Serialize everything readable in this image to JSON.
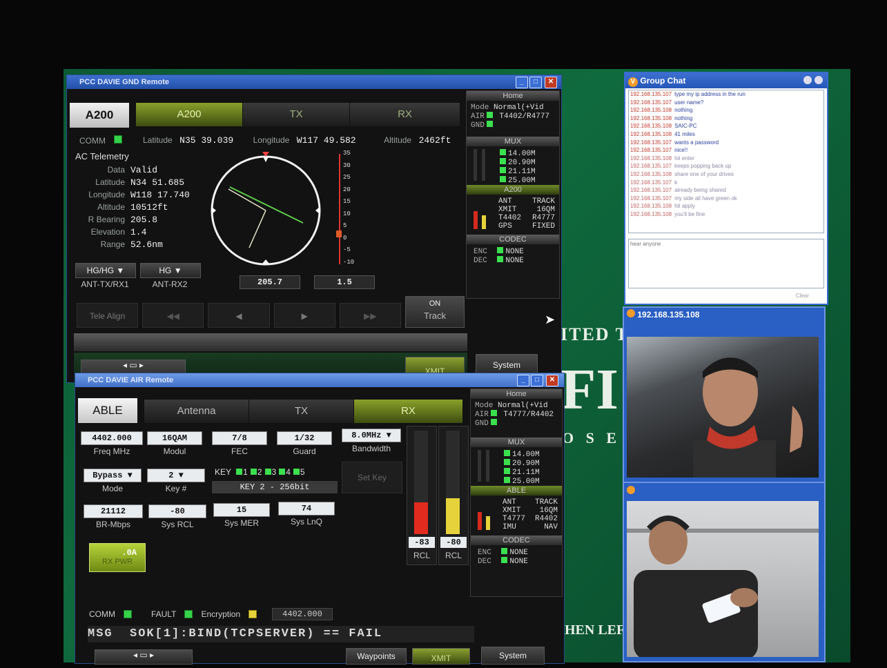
{
  "gnd": {
    "title": "PCC DAVIE GND Remote",
    "name_box": "A200",
    "tabs": [
      "A200",
      "TX",
      "RX"
    ],
    "comm_label": "COMM",
    "latitude_label": "Latitude",
    "latitude_value": "N35 39.039",
    "longitude_label": "Longitude",
    "longitude_value": "W117 49.582",
    "altitude_label": "Altitude",
    "altitude_value": "2462ft",
    "telemetry": {
      "heading": "AC Telemetry",
      "rows": [
        {
          "label": "Data",
          "value": "Valid"
        },
        {
          "label": "Latitude",
          "value": "N34 51.685"
        },
        {
          "label": "Longitude",
          "value": "W118 17.740"
        },
        {
          "label": "Altitude",
          "value": "10512ft"
        },
        {
          "label": "R Bearing",
          "value": "205.8"
        },
        {
          "label": "Elevation",
          "value": "1.4"
        },
        {
          "label": "Range",
          "value": "52.6nm"
        }
      ]
    },
    "scale_ticks": [
      "35",
      "30",
      "25",
      "20",
      "15",
      "10",
      "5",
      "0",
      "-5",
      "-10"
    ],
    "bearing_readout": "205.7",
    "elevation_readout": "1.5",
    "ant_tx": {
      "value": "HG/HG",
      "label": "ANT-TX/RX1"
    },
    "ant_rx": {
      "value": "HG",
      "label": "ANT-RX2"
    },
    "tele_align": "Tele Align",
    "on_label": "ON",
    "track_label": "Track",
    "system_label": "System",
    "xmit_label": "XMIT",
    "status": {
      "home_label": "Home",
      "mode_label": "Mode",
      "mode_value": "Normal(+Vid",
      "air_label": "AIR",
      "gnd_label": "GND",
      "link_value": "T4402/R4777",
      "mux_label": "MUX",
      "mux_values": [
        "14.00M",
        "20.90M",
        "21.11M",
        "25.00M"
      ],
      "section_label": "A200",
      "ant_label": "ANT",
      "track_label": "TRACK",
      "xmit_label": "XMIT",
      "xmit_value": "16QM",
      "t_label": "T4402",
      "r_label": "R4777",
      "gps_label": "GPS",
      "gps_value": "FIXED",
      "codec_label": "CODEC",
      "enc_label": "ENC",
      "dec_label": "DEC",
      "enc_value": "NONE",
      "dec_value": "NONE"
    }
  },
  "air": {
    "title": "PCC DAVIE AIR Remote",
    "name_box": "ABLE",
    "tabs": [
      "Antenna",
      "TX",
      "RX"
    ],
    "freq": {
      "value": "4402.000",
      "label": "Freq MHz"
    },
    "modul": {
      "value": "16QAM",
      "label": "Modul"
    },
    "fec": {
      "value": "7/8",
      "label": "FEC"
    },
    "guard": {
      "value": "1/32",
      "label": "Guard"
    },
    "bandwidth": {
      "value": "8.0MHz",
      "label": "Bandwidth"
    },
    "mode": {
      "value": "Bypass",
      "label": "Mode"
    },
    "key_num": {
      "value": "2",
      "label": "Key #"
    },
    "key_label": "KEY",
    "key_slots": [
      "1",
      "2",
      "3",
      "4",
      "5"
    ],
    "key_info": "KEY 2 - 256bit",
    "set_key": "Set Key",
    "br": {
      "value": "21112",
      "label": "BR-Mbps"
    },
    "sys_rcl": {
      "value": "-80",
      "label": "Sys RCL"
    },
    "sys_mer": {
      "value": "15",
      "label": "Sys MER"
    },
    "sys_lnq": {
      "value": "74",
      "label": "Sys LnQ"
    },
    "rx_pwr": {
      "value": ".0A",
      "label": "RX PWR"
    },
    "rcl1": {
      "value": "-83",
      "label": "RCL"
    },
    "rcl2": {
      "value": "-80",
      "label": "RCL"
    },
    "comm_label": "COMM",
    "fault_label": "FAULT",
    "encryption_label": "Encryption",
    "freq_readout": "4402.000",
    "msg": "MSG  SOK[1]:BIND(TCPSERVER) == FAIL",
    "waypoints_label": "Waypoints",
    "xmit_label": "XMIT",
    "system_label": "System",
    "status": {
      "home_label": "Home",
      "mode_label": "Mode",
      "mode_value": "Normal(+Vid",
      "air_label": "AIR",
      "gnd_label": "GND",
      "link_value": "T4777/R4402",
      "mux_label": "MUX",
      "mux_values": [
        "14.00M",
        "20.90M",
        "21.11M",
        "25.00M"
      ],
      "section_label": "ABLE",
      "ant_label": "ANT",
      "track_label": "TRACK",
      "xmit_label": "XMIT",
      "xmit_value": "16QM",
      "t_label": "T4777",
      "r_label": "R4402",
      "imu_label": "IMU",
      "imu_value": "NAV",
      "codec_label": "CODEC",
      "enc_label": "ENC",
      "dec_label": "DEC",
      "enc_value": "NONE",
      "dec_value": "NONE"
    }
  },
  "chat": {
    "title": "Group Chat",
    "messages": [
      {
        "from": "192.168.135.107",
        "text": "type my ip address in the run"
      },
      {
        "from": "192.168.135.107",
        "text": "user name?"
      },
      {
        "from": "192.168.135.108",
        "text": "nothing"
      },
      {
        "from": "192.168.135.108",
        "text": "nothing"
      },
      {
        "from": "192.168.135.108",
        "text": "SAIC-PC"
      },
      {
        "from": "192.168.135.108",
        "text": "41 miles"
      },
      {
        "from": "192.168.135.107",
        "text": "wants a password"
      },
      {
        "from": "192.168.135.107",
        "text": "nice!!"
      },
      {
        "from": "192.168.135.108",
        "text": "hit enter"
      },
      {
        "from": "192.168.135.107",
        "text": "keeps popping back up"
      },
      {
        "from": "192.168.135.108",
        "text": "share one of your drives"
      },
      {
        "from": "192.168.135.107",
        "text": "k"
      },
      {
        "from": "192.168.135.107",
        "text": "already being shared"
      },
      {
        "from": "192.168.135.107",
        "text": "my side all have green ok"
      },
      {
        "from": "192.168.135.108",
        "text": "hit apply"
      },
      {
        "from": "192.168.135.108",
        "text": "you'll be fine"
      }
    ],
    "input_text": "hear anyone",
    "clear_label": "Clear"
  },
  "cam1": {
    "title": "192.168.135.108"
  },
  "desktop": {
    "sign_line1": "ITED T",
    "sign_line2": "FI",
    "sign_line3": "O S E",
    "sign_line4": "HEN LEF"
  }
}
